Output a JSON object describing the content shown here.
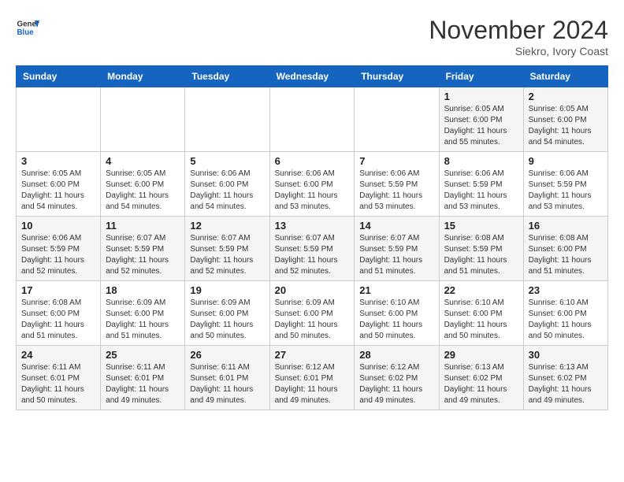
{
  "logo": {
    "line1": "General",
    "line2": "Blue"
  },
  "title": "November 2024",
  "location": "Siekro, Ivory Coast",
  "days_of_week": [
    "Sunday",
    "Monday",
    "Tuesday",
    "Wednesday",
    "Thursday",
    "Friday",
    "Saturday"
  ],
  "weeks": [
    [
      {
        "num": "",
        "info": ""
      },
      {
        "num": "",
        "info": ""
      },
      {
        "num": "",
        "info": ""
      },
      {
        "num": "",
        "info": ""
      },
      {
        "num": "",
        "info": ""
      },
      {
        "num": "1",
        "info": "Sunrise: 6:05 AM\nSunset: 6:00 PM\nDaylight: 11 hours and 55 minutes."
      },
      {
        "num": "2",
        "info": "Sunrise: 6:05 AM\nSunset: 6:00 PM\nDaylight: 11 hours and 54 minutes."
      }
    ],
    [
      {
        "num": "3",
        "info": "Sunrise: 6:05 AM\nSunset: 6:00 PM\nDaylight: 11 hours and 54 minutes."
      },
      {
        "num": "4",
        "info": "Sunrise: 6:05 AM\nSunset: 6:00 PM\nDaylight: 11 hours and 54 minutes."
      },
      {
        "num": "5",
        "info": "Sunrise: 6:06 AM\nSunset: 6:00 PM\nDaylight: 11 hours and 54 minutes."
      },
      {
        "num": "6",
        "info": "Sunrise: 6:06 AM\nSunset: 6:00 PM\nDaylight: 11 hours and 53 minutes."
      },
      {
        "num": "7",
        "info": "Sunrise: 6:06 AM\nSunset: 5:59 PM\nDaylight: 11 hours and 53 minutes."
      },
      {
        "num": "8",
        "info": "Sunrise: 6:06 AM\nSunset: 5:59 PM\nDaylight: 11 hours and 53 minutes."
      },
      {
        "num": "9",
        "info": "Sunrise: 6:06 AM\nSunset: 5:59 PM\nDaylight: 11 hours and 53 minutes."
      }
    ],
    [
      {
        "num": "10",
        "info": "Sunrise: 6:06 AM\nSunset: 5:59 PM\nDaylight: 11 hours and 52 minutes."
      },
      {
        "num": "11",
        "info": "Sunrise: 6:07 AM\nSunset: 5:59 PM\nDaylight: 11 hours and 52 minutes."
      },
      {
        "num": "12",
        "info": "Sunrise: 6:07 AM\nSunset: 5:59 PM\nDaylight: 11 hours and 52 minutes."
      },
      {
        "num": "13",
        "info": "Sunrise: 6:07 AM\nSunset: 5:59 PM\nDaylight: 11 hours and 52 minutes."
      },
      {
        "num": "14",
        "info": "Sunrise: 6:07 AM\nSunset: 5:59 PM\nDaylight: 11 hours and 51 minutes."
      },
      {
        "num": "15",
        "info": "Sunrise: 6:08 AM\nSunset: 5:59 PM\nDaylight: 11 hours and 51 minutes."
      },
      {
        "num": "16",
        "info": "Sunrise: 6:08 AM\nSunset: 6:00 PM\nDaylight: 11 hours and 51 minutes."
      }
    ],
    [
      {
        "num": "17",
        "info": "Sunrise: 6:08 AM\nSunset: 6:00 PM\nDaylight: 11 hours and 51 minutes."
      },
      {
        "num": "18",
        "info": "Sunrise: 6:09 AM\nSunset: 6:00 PM\nDaylight: 11 hours and 51 minutes."
      },
      {
        "num": "19",
        "info": "Sunrise: 6:09 AM\nSunset: 6:00 PM\nDaylight: 11 hours and 50 minutes."
      },
      {
        "num": "20",
        "info": "Sunrise: 6:09 AM\nSunset: 6:00 PM\nDaylight: 11 hours and 50 minutes."
      },
      {
        "num": "21",
        "info": "Sunrise: 6:10 AM\nSunset: 6:00 PM\nDaylight: 11 hours and 50 minutes."
      },
      {
        "num": "22",
        "info": "Sunrise: 6:10 AM\nSunset: 6:00 PM\nDaylight: 11 hours and 50 minutes."
      },
      {
        "num": "23",
        "info": "Sunrise: 6:10 AM\nSunset: 6:00 PM\nDaylight: 11 hours and 50 minutes."
      }
    ],
    [
      {
        "num": "24",
        "info": "Sunrise: 6:11 AM\nSunset: 6:01 PM\nDaylight: 11 hours and 50 minutes."
      },
      {
        "num": "25",
        "info": "Sunrise: 6:11 AM\nSunset: 6:01 PM\nDaylight: 11 hours and 49 minutes."
      },
      {
        "num": "26",
        "info": "Sunrise: 6:11 AM\nSunset: 6:01 PM\nDaylight: 11 hours and 49 minutes."
      },
      {
        "num": "27",
        "info": "Sunrise: 6:12 AM\nSunset: 6:01 PM\nDaylight: 11 hours and 49 minutes."
      },
      {
        "num": "28",
        "info": "Sunrise: 6:12 AM\nSunset: 6:02 PM\nDaylight: 11 hours and 49 minutes."
      },
      {
        "num": "29",
        "info": "Sunrise: 6:13 AM\nSunset: 6:02 PM\nDaylight: 11 hours and 49 minutes."
      },
      {
        "num": "30",
        "info": "Sunrise: 6:13 AM\nSunset: 6:02 PM\nDaylight: 11 hours and 49 minutes."
      }
    ]
  ]
}
